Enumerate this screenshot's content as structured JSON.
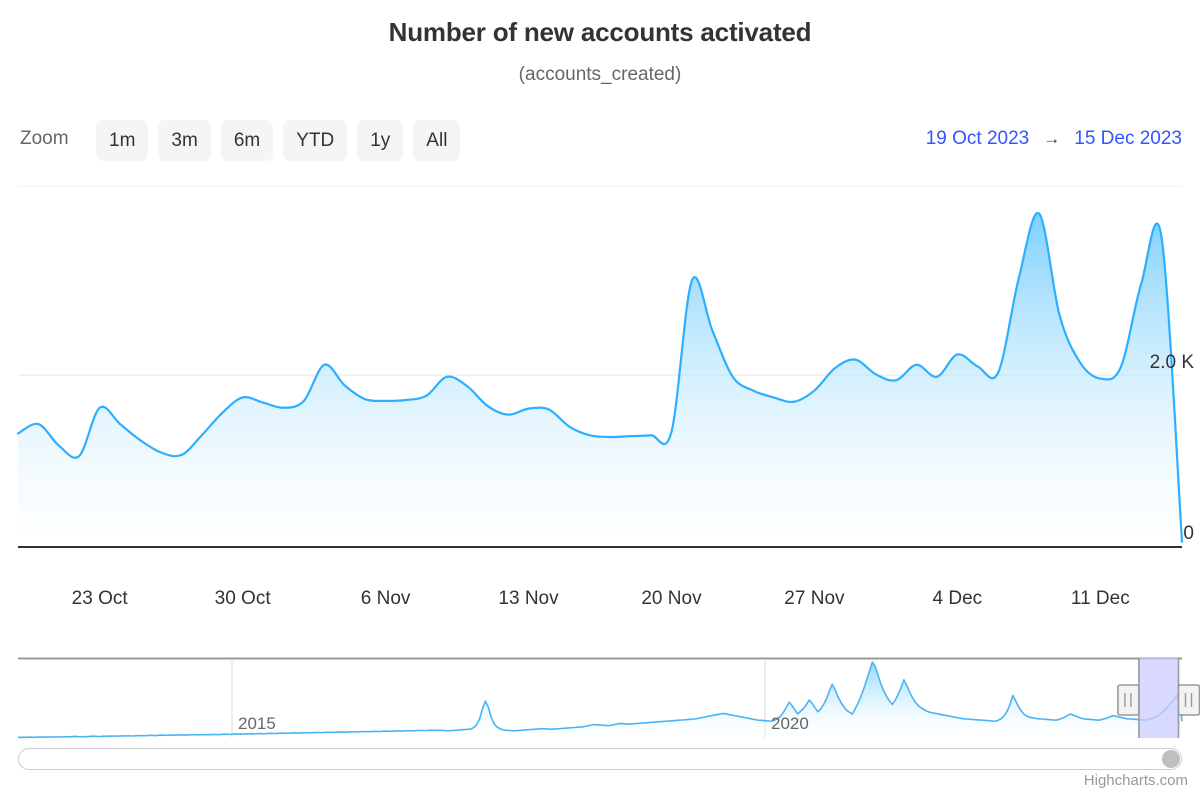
{
  "title": "Number of new accounts activated",
  "subtitle": "(accounts_created)",
  "rangeselector": {
    "label": "Zoom",
    "buttons": [
      {
        "label": "1m",
        "selected": false
      },
      {
        "label": "3m",
        "selected": false
      },
      {
        "label": "6m",
        "selected": false
      },
      {
        "label": "YTD",
        "selected": false
      },
      {
        "label": "1y",
        "selected": false
      },
      {
        "label": "All",
        "selected": false
      }
    ],
    "input_from": "19 Oct 2023",
    "input_to": "15 Dec 2023",
    "arrow": "→",
    "input_color": "#3355ff"
  },
  "credits": "Highcharts.com",
  "colors": {
    "series_line": "#2caffe",
    "series_fill_top": "#7ed0fb",
    "series_fill_bottom": "#ffffff",
    "gridline": "#e6e6e6",
    "axis_line": "#333333",
    "navigator_mask": "#ccccff",
    "navigator_handle": "#f2f2f2",
    "navigator_outline": "#999999",
    "scrollbar_thumb": "#bfbfbf"
  },
  "chart_data": {
    "type": "area",
    "title": "Number of new accounts activated",
    "subtitle": "(accounts_created)",
    "xlabel": "",
    "ylabel": "",
    "grid": true,
    "legend": null,
    "xaxis": {
      "type": "datetime",
      "range_start": "19 Oct 2023",
      "range_end": "15 Dec 2023",
      "tick_labels": [
        "23 Oct",
        "30 Oct",
        "6 Nov",
        "13 Nov",
        "20 Nov",
        "27 Nov",
        "4 Dec",
        "11 Dec"
      ]
    },
    "yaxis": {
      "tick_labels": [
        "0",
        "2.0 K"
      ],
      "tick_values": [
        0,
        2000
      ],
      "ylim": [
        0,
        4200
      ],
      "opposite": true
    },
    "series": [
      {
        "name": "accounts_created",
        "x": [
          "19 Oct 2023",
          "20 Oct 2023",
          "21 Oct 2023",
          "22 Oct 2023",
          "23 Oct 2023",
          "24 Oct 2023",
          "25 Oct 2023",
          "26 Oct 2023",
          "27 Oct 2023",
          "28 Oct 2023",
          "29 Oct 2023",
          "30 Oct 2023",
          "31 Oct 2023",
          "1 Nov 2023",
          "2 Nov 2023",
          "3 Nov 2023",
          "4 Nov 2023",
          "5 Nov 2023",
          "6 Nov 2023",
          "7 Nov 2023",
          "8 Nov 2023",
          "9 Nov 2023",
          "10 Nov 2023",
          "11 Nov 2023",
          "12 Nov 2023",
          "13 Nov 2023",
          "14 Nov 2023",
          "15 Nov 2023",
          "16 Nov 2023",
          "17 Nov 2023",
          "18 Nov 2023",
          "19 Nov 2023",
          "20 Nov 2023",
          "21 Nov 2023",
          "22 Nov 2023",
          "23 Nov 2023",
          "24 Nov 2023",
          "25 Nov 2023",
          "26 Nov 2023",
          "27 Nov 2023",
          "28 Nov 2023",
          "29 Nov 2023",
          "30 Nov 2023",
          "1 Dec 2023",
          "2 Dec 2023",
          "3 Dec 2023",
          "4 Dec 2023",
          "5 Dec 2023",
          "6 Dec 2023",
          "7 Dec 2023",
          "8 Dec 2023",
          "9 Dec 2023",
          "10 Dec 2023",
          "11 Dec 2023",
          "12 Dec 2023",
          "13 Dec 2023",
          "14 Dec 2023",
          "15 Dec 2023"
        ],
        "values": [
          1320,
          1430,
          1180,
          1060,
          1620,
          1430,
          1240,
          1100,
          1070,
          1300,
          1560,
          1740,
          1680,
          1620,
          1700,
          2120,
          1880,
          1720,
          1700,
          1710,
          1760,
          1980,
          1870,
          1640,
          1540,
          1610,
          1600,
          1400,
          1300,
          1280,
          1290,
          1300,
          1340,
          3100,
          2520,
          1980,
          1820,
          1740,
          1690,
          1820,
          2080,
          2180,
          2010,
          1940,
          2120,
          1980,
          2240,
          2100,
          2030,
          3120,
          3880,
          2700,
          2150,
          1960,
          2090,
          3060,
          3600,
          60
        ]
      }
    ],
    "navigator": {
      "xaxis_tick_labels": [
        "2015",
        "2020"
      ],
      "selected_range_fraction": [
        0.963,
        0.997
      ]
    }
  }
}
